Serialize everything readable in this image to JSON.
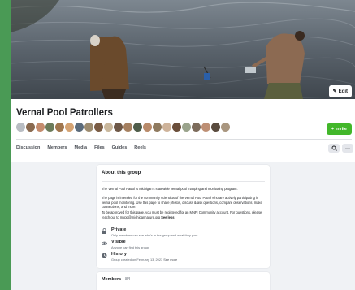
{
  "group": {
    "name": "Vernal Pool Patrollers",
    "edit_label": "Edit",
    "invite_label": "+ Invite"
  },
  "tabs": [
    "Discussion",
    "Members",
    "Media",
    "Files",
    "Guides",
    "Reels"
  ],
  "tab_actions": {
    "search_icon": "search-icon",
    "more_label": "···"
  },
  "about": {
    "heading": "About this group",
    "paragraphs": [
      "The Vernal Pool Patrol is Michigan's statewide vernal pool mapping and monitoring program.",
      "The page is intended for the community scientists of the Vernal Pool Patrol who are actively participating in vernal pool monitoring. Use this page to share photos, discuss & ask questions, compare observations, make connections, and more.",
      "To be approved for this page, you must be registered for an MNFI Community account. For questions, please reach out to mvpp@michigannature.org"
    ],
    "see_less": "See less",
    "private": {
      "title": "Private",
      "desc": "Only members can see who's in the group and what they post."
    },
    "visible": {
      "title": "Visible",
      "desc": "Anyone can find this group."
    },
    "history": {
      "title": "History",
      "desc": "Group created on February 13, 2023",
      "see_more": "See more"
    }
  },
  "members": {
    "label": "Members",
    "separator": " · ",
    "count": "84"
  },
  "colors": {
    "accent_green": "#42b72a",
    "background": "#f0f2f5",
    "outer_border": "#4a9a55"
  },
  "avatar_colors": [
    "#b9bdc3",
    "#8a6a50",
    "#c48c6e",
    "#6b7b5a",
    "#a0764e",
    "#d4a373",
    "#5b6b7b",
    "#9c8b6f",
    "#7a5c44",
    "#c9b79c",
    "#6e5847",
    "#a58060",
    "#4f5d4a",
    "#b88a6a",
    "#8f7a5f",
    "#ceb39a",
    "#6a4e3a",
    "#9aa38c",
    "#7d6c5c",
    "#bd8f74",
    "#5a4b3e",
    "#a9967f"
  ]
}
